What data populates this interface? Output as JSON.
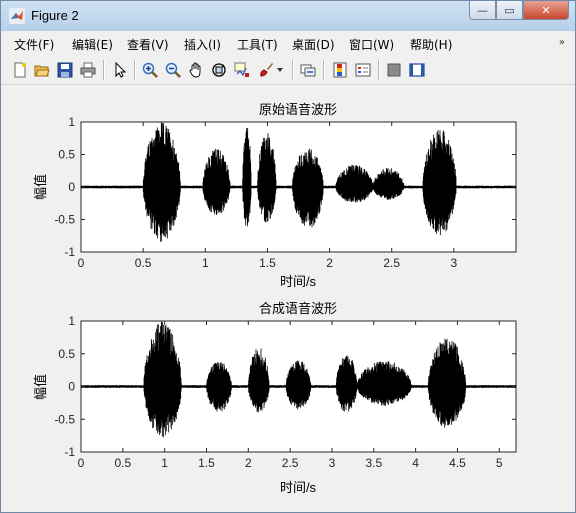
{
  "window": {
    "title": "Figure 2",
    "minimize_glyph": "—",
    "maximize_glyph": "▭",
    "close_glyph": "✕"
  },
  "menubar": {
    "items": [
      "文件(F)",
      "编辑(E)",
      "查看(V)",
      "插入(I)",
      "工具(T)",
      "桌面(D)",
      "窗口(W)",
      "帮助(H)"
    ],
    "overflow_icon": "double-chevron-icon"
  },
  "toolbar": {
    "icons": [
      "new-figure-icon",
      "open-file-icon",
      "save-icon",
      "print-icon",
      "edit-plot-arrow-icon",
      "zoom-in-icon",
      "zoom-out-icon",
      "pan-hand-icon",
      "rotate-3d-icon",
      "data-cursor-icon",
      "brush-icon",
      "brush-dropdown-icon",
      "link-plot-icon",
      "insert-colorbar-icon",
      "insert-legend-icon",
      "hide-plot-tools-icon",
      "show-plot-tools-icon"
    ]
  },
  "chart_data": [
    {
      "type": "line",
      "title": "原始语音波形",
      "xlabel": "时间/s",
      "ylabel": "幅值",
      "xlim": [
        0,
        3.5
      ],
      "ylim": [
        -1,
        1
      ],
      "xticks": [
        "0",
        "0.5",
        "1",
        "1.5",
        "2",
        "2.5",
        "3"
      ],
      "yticks": [
        "1",
        "0.5",
        "0",
        "-0.5",
        "-1"
      ],
      "color": "#000000",
      "segments": [
        {
          "start": 0.5,
          "end": 0.8,
          "peak": 1.0,
          "trough": -0.85
        },
        {
          "start": 0.98,
          "end": 1.2,
          "peak": 0.6,
          "trough": -0.45
        },
        {
          "start": 1.3,
          "end": 1.37,
          "peak": 0.95,
          "trough": -0.65
        },
        {
          "start": 1.42,
          "end": 1.57,
          "peak": 0.85,
          "trough": -0.55
        },
        {
          "start": 1.7,
          "end": 1.95,
          "peak": 0.6,
          "trough": -0.65
        },
        {
          "start": 2.05,
          "end": 2.35,
          "peak": 0.35,
          "trough": -0.25
        },
        {
          "start": 2.35,
          "end": 2.6,
          "peak": 0.3,
          "trough": -0.2
        },
        {
          "start": 2.75,
          "end": 3.02,
          "peak": 0.9,
          "trough": -0.75
        }
      ]
    },
    {
      "type": "line",
      "title": "合成语音波形",
      "xlabel": "时间/s",
      "ylabel": "幅值",
      "xlim": [
        0,
        5.2
      ],
      "ylim": [
        -1,
        1
      ],
      "xticks": [
        "0",
        "0.5",
        "1",
        "1.5",
        "2",
        "2.5",
        "3",
        "3.5",
        "4",
        "4.5",
        "5"
      ],
      "yticks": [
        "1",
        "0.5",
        "0",
        "-0.5",
        "-1"
      ],
      "color": "#000000",
      "segments": [
        {
          "start": 0.75,
          "end": 1.2,
          "peak": 1.0,
          "trough": -0.78
        },
        {
          "start": 1.5,
          "end": 1.8,
          "peak": 0.4,
          "trough": -0.4
        },
        {
          "start": 2.0,
          "end": 2.25,
          "peak": 0.6,
          "trough": -0.4
        },
        {
          "start": 2.45,
          "end": 2.75,
          "peak": 0.4,
          "trough": -0.35
        },
        {
          "start": 3.05,
          "end": 3.3,
          "peak": 0.5,
          "trough": -0.4
        },
        {
          "start": 3.3,
          "end": 3.95,
          "peak": 0.4,
          "trough": -0.3
        },
        {
          "start": 4.15,
          "end": 4.6,
          "peak": 0.75,
          "trough": -0.65
        }
      ]
    }
  ]
}
